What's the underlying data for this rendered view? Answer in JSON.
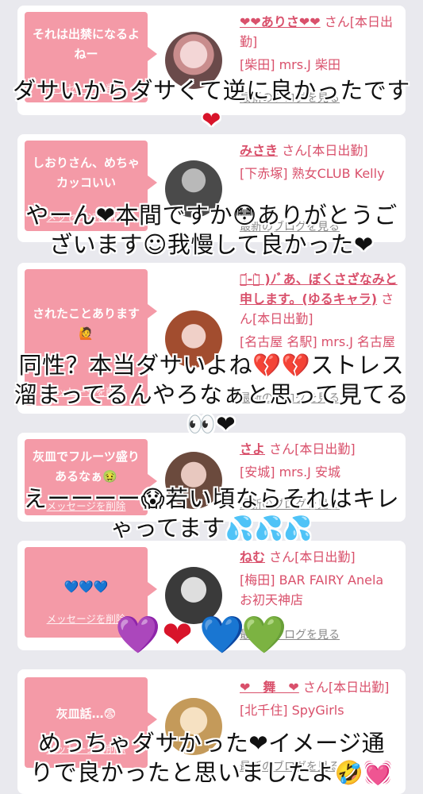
{
  "cards": [
    {
      "message": "それは出禁になるよねー",
      "delete_label": "メッセージを削除",
      "name": "❤❤ありさ❤❤",
      "san": "さん[本日出勤]",
      "shop": "[柴田] mrs.J 柴田",
      "blog_label": "最新のブログを見る"
    },
    {
      "message": "しおりさん、めちゃカッコいい",
      "delete_label": "メッセージを削除",
      "name": "みさき",
      "san": "さん[本日出勤]",
      "shop": "[下赤塚] 熟女CLUB Kelly",
      "blog_label": "最新のブログを見る"
    },
    {
      "message": "されたことあります🙋",
      "delete_label": "メッセージを削除",
      "name": "･᷄-･᷅ )ﾉﾞあ、ぼくさざなみと申します。(ゆるキャラ)",
      "san": "さん[本日出勤]",
      "shop": "[名古屋 名駅] mrs.J 名古屋",
      "blog_label": "最新のブログを見る"
    },
    {
      "message": "灰皿でフルーツ盛りあるなぁ🤢",
      "delete_label": "メッセージを削除",
      "name": "さよ",
      "san": "さん[本日出勤]",
      "shop": "[安城] mrs.J 安城",
      "blog_label": "最新のブログを見る"
    },
    {
      "message": "💙💙💙",
      "delete_label": "メッセージを削除",
      "name": "ねむ",
      "san": "さん[本日出勤]",
      "shop": "[梅田] BAR FAIRY Anela お初天神店",
      "blog_label": "最新のブログを見る"
    },
    {
      "message": "灰皿話…😨",
      "delete_label": "メッセージを削除",
      "name": "❤　舞　❤",
      "san": "さん[本日出勤]",
      "shop": "[北千住] SpyGirls",
      "blog_label": "最新のブログを見る"
    }
  ],
  "overlays": [
    "ダサいからダサくて逆に良かったです❤",
    "やーん❤本間ですか😳ありがとうございます☺我慢して良かった❤",
    "同性？本当ダサいよね💔💔ストレス溜まってるんやろなぁと思って見てる👀❤",
    "えーーーー😱若い頃ならそれはキレやってます💦💦💦",
    "めっちゃダサかった❤イメージ通りで良かったと思いましたよ🤣💓"
  ],
  "overlay_lines": [
    [
      "ダサいからダサくて逆に良かったです",
      "❤"
    ],
    [
      "やーん❤本間ですか😳ありがとうご",
      "ざいます☺我慢して良かった❤"
    ],
    [
      "同性？本当ダサいよね💔💔ストレス",
      "溜まってるんやろなぁと思って見てる",
      "👀❤"
    ],
    [
      "えーーーー😱若い頃ならそれはキレ",
      "ゃってます💦💦💦"
    ],
    [
      "めっちゃダサかった❤イメージ通",
      "りで良かったと思いましたよ🤣💓"
    ]
  ],
  "big_hearts": [
    "💜",
    "❤",
    "💙",
    "💚"
  ],
  "colors": {
    "background": "#e9e9ee",
    "bubble": "#f49aa7",
    "accent_text": "#d9506b",
    "muted_link": "#8a8a8a"
  }
}
